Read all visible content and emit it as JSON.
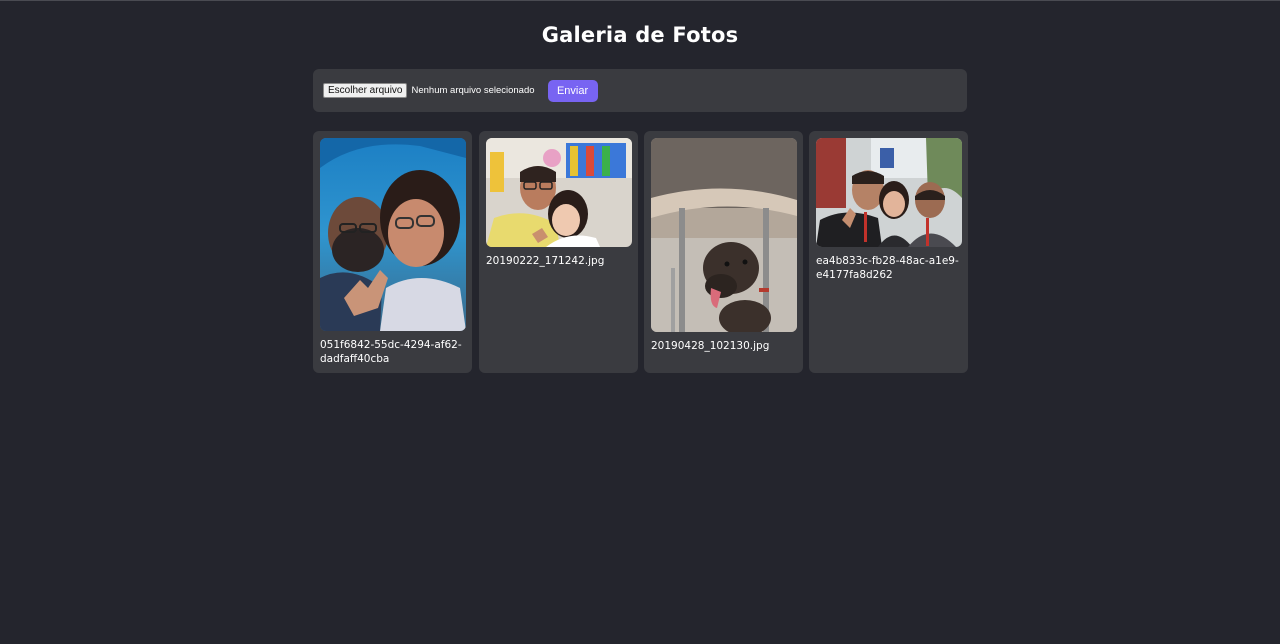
{
  "page": {
    "title": "Galeria de Fotos"
  },
  "upload": {
    "file_button_label": "Escolher arquivo",
    "file_status": "Nenhum arquivo selecionado",
    "submit_label": "Enviar"
  },
  "photos": [
    {
      "caption": "051f6842-55dc-4294-af62-dadfaff40cba"
    },
    {
      "caption": "20190222_171242.jpg"
    },
    {
      "caption": "20190428_102130.jpg"
    },
    {
      "caption": "ea4b833c-fb28-48ac-a1e9-e4177fa8d262"
    }
  ],
  "colors": {
    "background": "#24252d",
    "card": "#3a3b40",
    "accent": "#7864f2",
    "text": "#ffffff"
  }
}
